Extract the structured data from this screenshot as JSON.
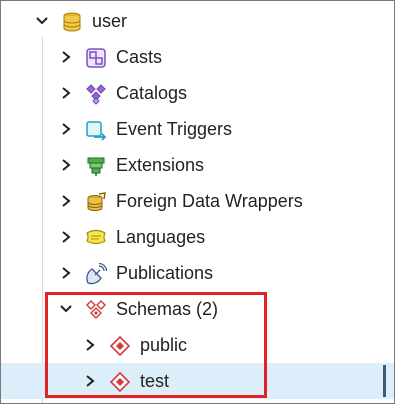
{
  "tree": {
    "root": {
      "label": "user",
      "icon": "database-icon",
      "expanded": true
    },
    "items": [
      {
        "label": "Casts",
        "icon": "casts-icon",
        "expanded": false
      },
      {
        "label": "Catalogs",
        "icon": "catalogs-icon",
        "expanded": false
      },
      {
        "label": "Event Triggers",
        "icon": "event-triggers-icon",
        "expanded": false
      },
      {
        "label": "Extensions",
        "icon": "extensions-icon",
        "expanded": false
      },
      {
        "label": "Foreign Data Wrappers",
        "icon": "foreign-data-wrappers-icon",
        "expanded": false
      },
      {
        "label": "Languages",
        "icon": "languages-icon",
        "expanded": false
      },
      {
        "label": "Publications",
        "icon": "publications-icon",
        "expanded": false
      },
      {
        "label": "Schemas (2)",
        "icon": "schemas-icon",
        "expanded": true
      }
    ],
    "schemas": [
      {
        "label": "public",
        "icon": "schema-icon",
        "expanded": false,
        "selected": false
      },
      {
        "label": "test",
        "icon": "schema-icon",
        "expanded": false,
        "selected": true
      }
    ]
  },
  "colors": {
    "highlight_border": "#e32323",
    "selected_row": "#dbeefa",
    "selection_bar": "#40597a"
  }
}
